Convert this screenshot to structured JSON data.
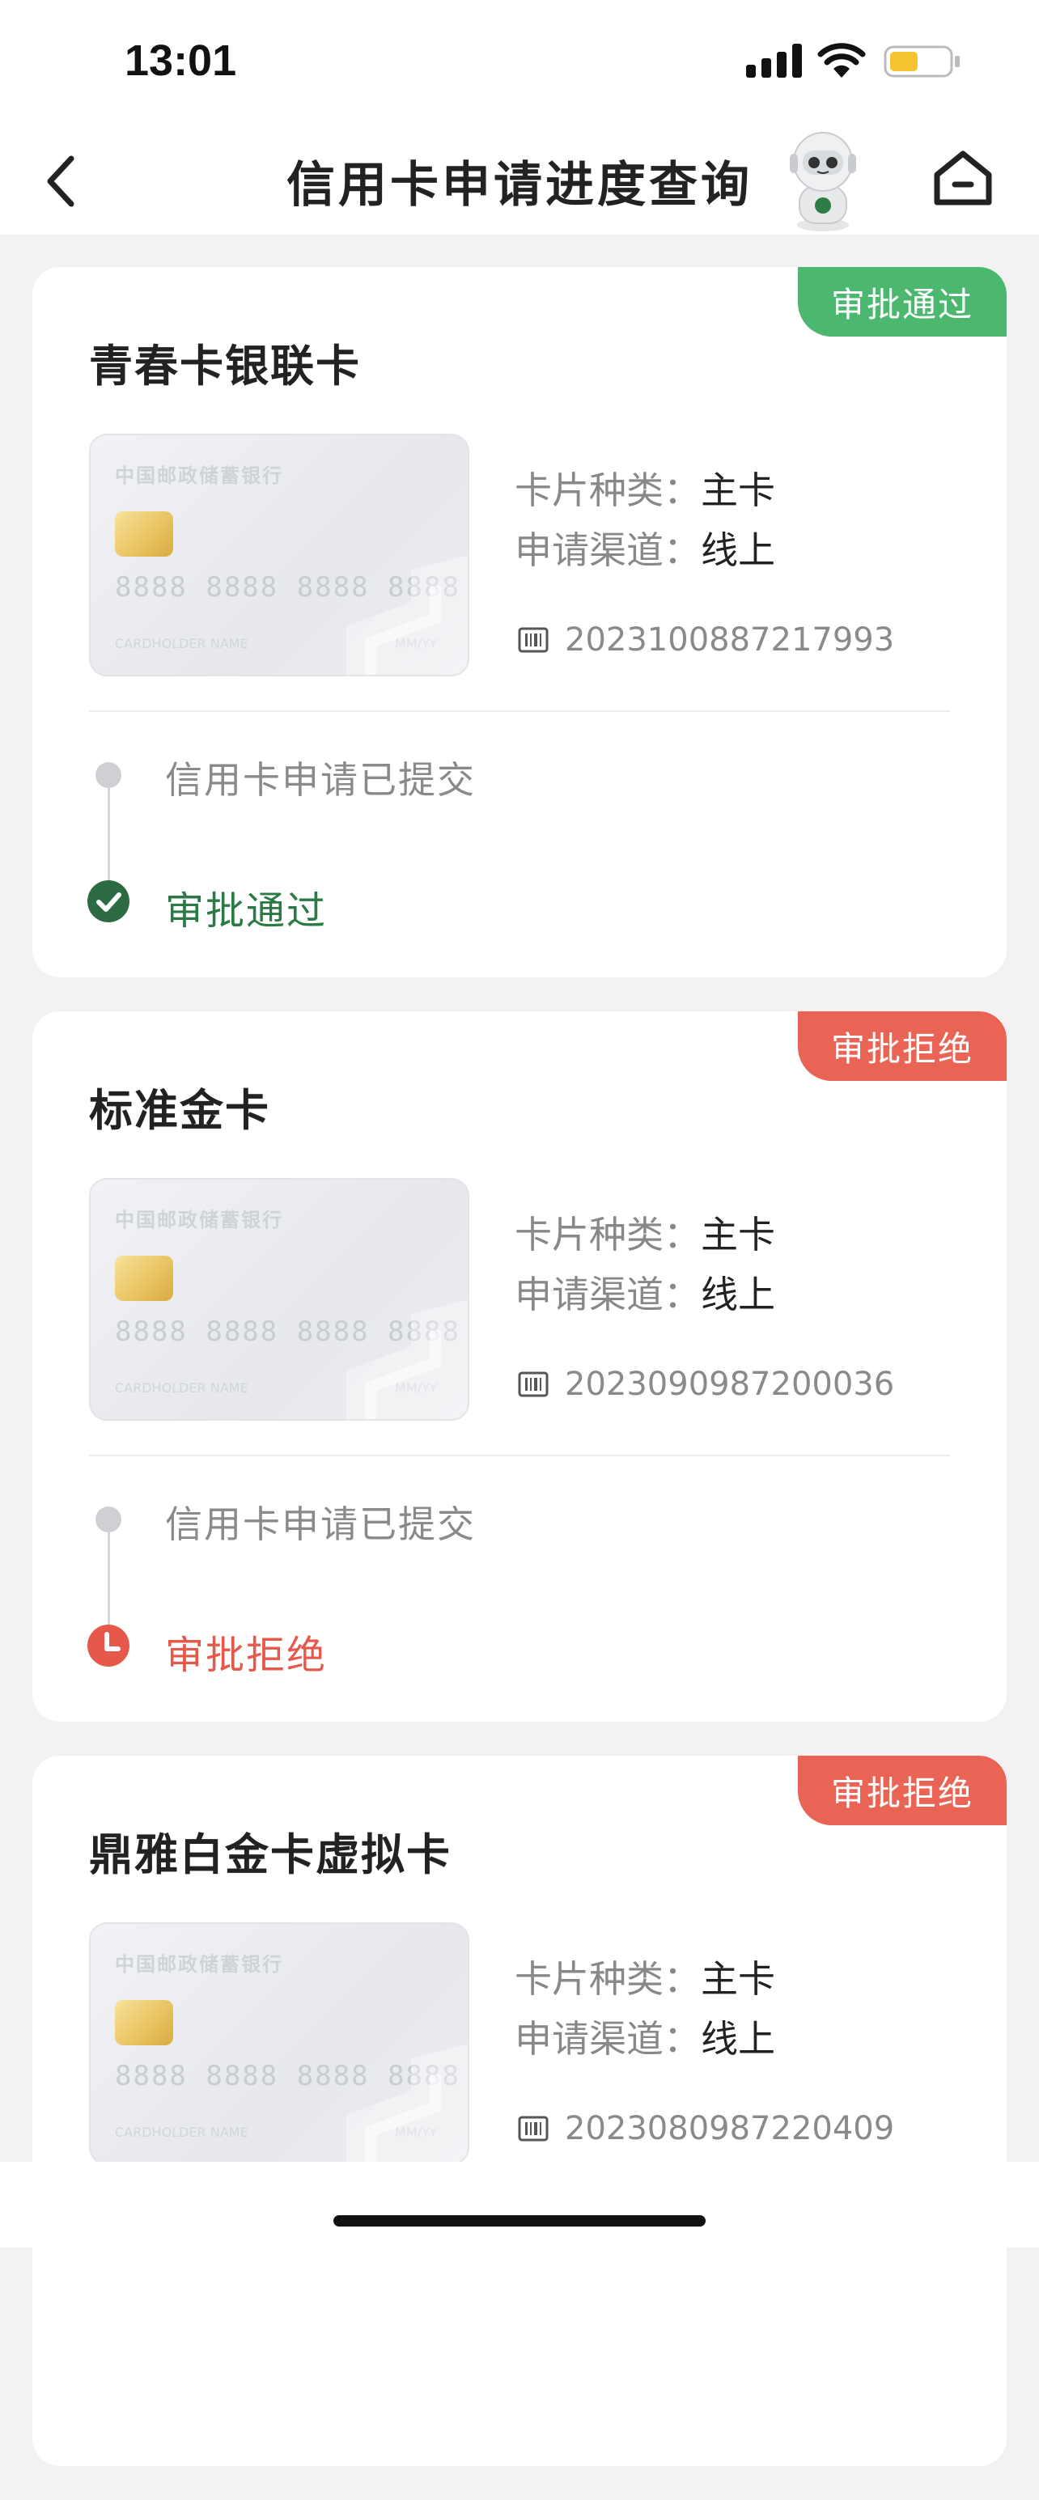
{
  "status_bar": {
    "time": "13:01"
  },
  "nav": {
    "title": "信用卡申请进度查询"
  },
  "cards": [
    {
      "title": "青春卡银联卡",
      "status": "审批通过",
      "status_type": "approved",
      "card_type_label": "卡片种类：",
      "card_type": "主卡",
      "channel_label": "申请渠道：",
      "channel": "线上",
      "application_number": "2023100887217993",
      "step1": "信用卡申请已提交",
      "step2": "审批通过",
      "card_image": {
        "bank": "中国邮政储蓄银行",
        "number": "8888 8888 8888 8888",
        "holder": "CARDHOLDER NAME",
        "expiry": "MM/YY"
      }
    },
    {
      "title": "标准金卡",
      "status": "审批拒绝",
      "status_type": "rejected",
      "card_type_label": "卡片种类：",
      "card_type": "主卡",
      "channel_label": "申请渠道：",
      "channel": "线上",
      "application_number": "2023090987200036",
      "step1": "信用卡申请已提交",
      "step2": "审批拒绝",
      "card_image": {
        "bank": "中国邮政储蓄银行",
        "number": "8888 8888 8888 8888",
        "holder": "CARDHOLDER NAME",
        "expiry": "MM/YY"
      }
    },
    {
      "title": "鼎雅白金卡虚拟卡",
      "status": "审批拒绝",
      "status_type": "rejected",
      "card_type_label": "卡片种类：",
      "card_type": "主卡",
      "channel_label": "申请渠道：",
      "channel": "线上",
      "application_number": "2023080987220409",
      "card_image": {
        "bank": "中国邮政储蓄银行",
        "number": "8888 8888 8888 8888",
        "holder": "CARDHOLDER NAME",
        "expiry": "MM/YY"
      }
    }
  ],
  "colors": {
    "approved": "#4cb86f",
    "approved_text": "#2b7a45",
    "rejected": "#e96454"
  },
  "icons": [
    "back-icon",
    "robot-mascot-icon",
    "home-icon",
    "barcode-icon",
    "check-circle-icon",
    "clock-icon",
    "signal-icon",
    "wifi-icon",
    "battery-icon"
  ]
}
